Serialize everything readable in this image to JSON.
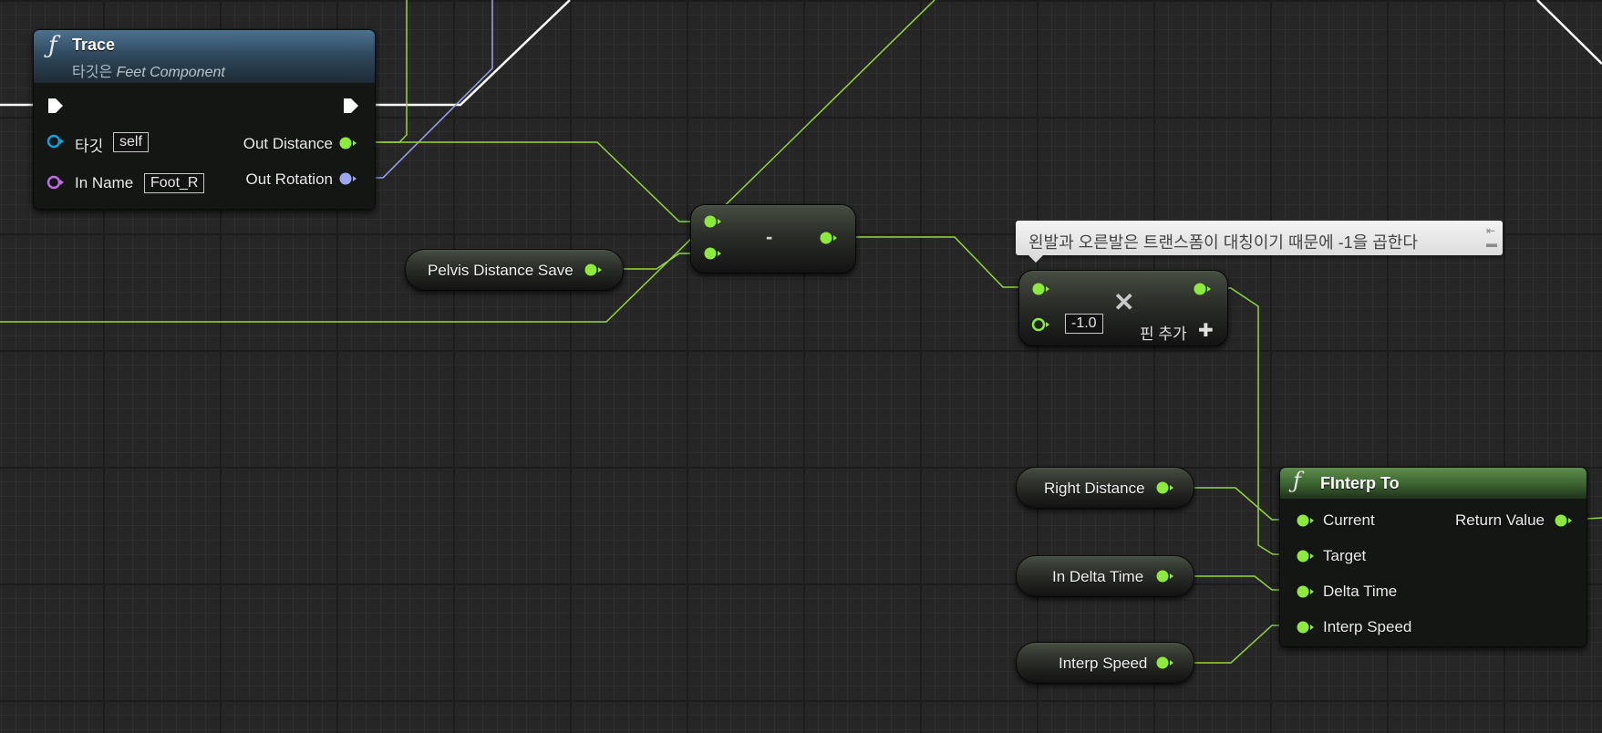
{
  "trace_node": {
    "title": "Trace",
    "subtitle_prefix": "타깃은",
    "subtitle_target": "Feet Component",
    "inputs": [
      {
        "label": "타깃",
        "value": "self"
      },
      {
        "label": "In Name",
        "value": "Foot_R"
      }
    ],
    "outputs": [
      {
        "label": "Out Distance"
      },
      {
        "label": "Out Rotation"
      }
    ]
  },
  "variables": {
    "pelvis_distance_save": "Pelvis Distance Save",
    "right_distance": "Right Distance",
    "in_delta_time": "In Delta Time",
    "interp_speed": "Interp Speed"
  },
  "subtract_node": {
    "label": "-"
  },
  "comment": {
    "text": "왼발과 오른발은 트랜스폼이 대칭이기 때문에 -1을 곱한다"
  },
  "multiply_node": {
    "value": "-1.0",
    "operator": "✕",
    "add_pin_label": "핀 추가",
    "add_pin_icon": "✚"
  },
  "finterp_node": {
    "title": "FInterp To",
    "inputs": [
      "Current",
      "Target",
      "Delta Time",
      "Interp Speed"
    ],
    "output": "Return Value"
  },
  "icons": {
    "function": "ƒ",
    "comment_pin": "📌"
  },
  "colors": {
    "float_pin": "#8cea3a",
    "exec_pin": "#ffffff",
    "object_pin": "#12a0d8",
    "name_pin": "#c36be6",
    "rotator_pin": "#9ba8f0",
    "float_wire": "#93d63b",
    "rotator_wire": "#9aa4f0",
    "exec_wire": "#ffffff"
  }
}
